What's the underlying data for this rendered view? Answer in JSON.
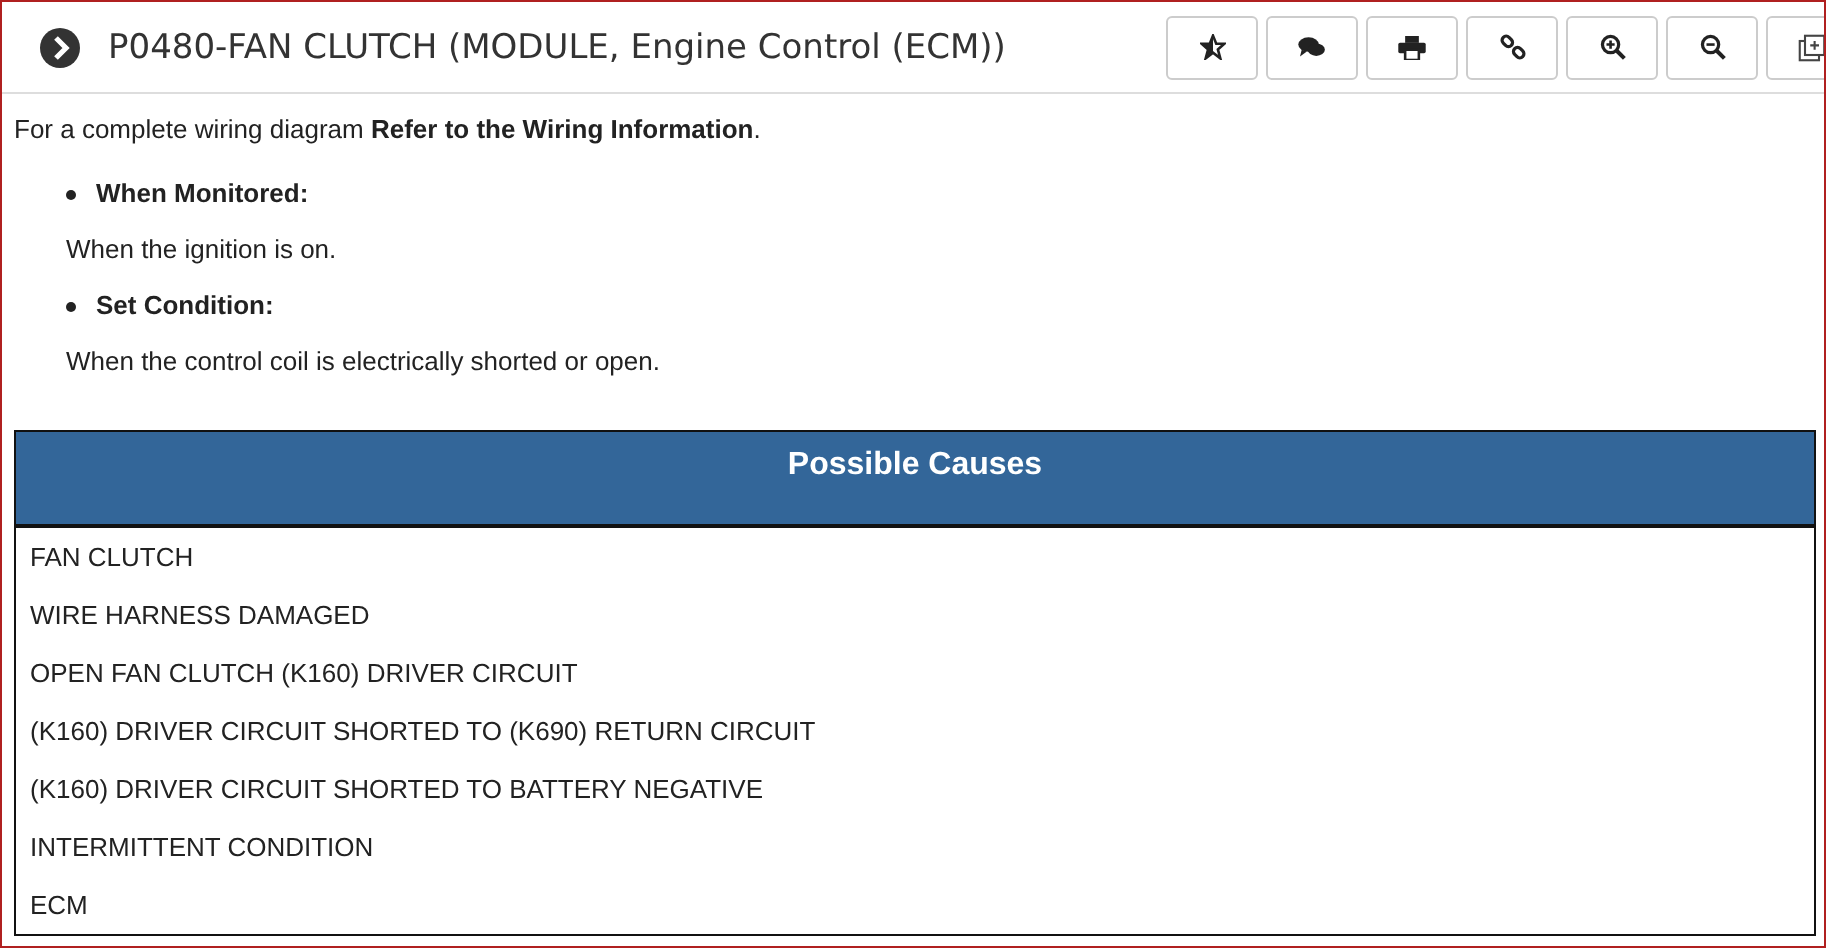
{
  "title": "P0480-FAN CLUTCH (MODULE, Engine Control (ECM))",
  "intro": "For a complete wiring diagram **Refer to the Wiring Information**.",
  "conditions": [
    {
      "heading": "When Monitored:",
      "text": "When the ignition is on."
    },
    {
      "heading": "Set Condition:",
      "text": "When the control coil is electrically shorted or open."
    }
  ],
  "causes": {
    "heading": "Possible Causes",
    "rows": [
      "FAN CLUTCH",
      "WIRE HARNESS DAMAGED",
      "OPEN FAN CLUTCH (K160) DRIVER CIRCUIT",
      "(K160) DRIVER CIRCUIT SHORTED TO (K690) RETURN CIRCUIT",
      "(K160) DRIVER CIRCUIT SHORTED TO BATTERY NEGATIVE",
      "INTERMITTENT CONDITION",
      "ECM"
    ]
  }
}
